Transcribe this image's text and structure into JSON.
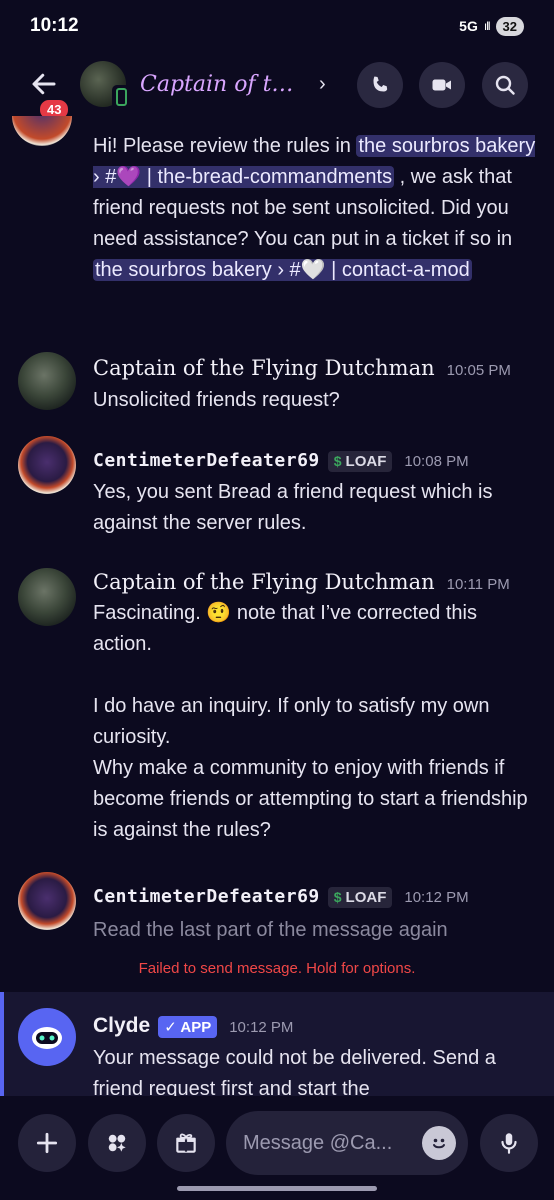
{
  "status_bar": {
    "time": "10:12",
    "network": "5G",
    "signal": "ıll",
    "battery": "32"
  },
  "header": {
    "unread_count": "43",
    "title": "Captain of the Flying Dutchman",
    "chevron": "›",
    "icons": [
      "back-arrow-icon",
      "phone-icon",
      "video-icon",
      "search-icon"
    ]
  },
  "messages": [
    {
      "id": "m0",
      "body_parts": [
        "Hi! Please review the rules in ",
        "the sourbros bakery › #💜 | the-bread-commandments",
        " , we ask that friend requests not be sent unsolicited. Did you need assistance? You can put in a ticket if so in ",
        "the sourbros bakery › #🤍 | contact-a-mod"
      ]
    },
    {
      "id": "m1",
      "author": "Captain of the Flying Dutchman",
      "time": "10:05 PM",
      "body": "Unsolicited friends request?"
    },
    {
      "id": "m2",
      "author": "CentimeterDefeater69",
      "tag_icon": "$",
      "tag": "LOAF",
      "time": "10:08 PM",
      "body": "Yes, you sent Bread a friend request which is against the server rules."
    },
    {
      "id": "m3",
      "author": "Captain of the Flying Dutchman",
      "time": "10:11 PM",
      "body_line1": "Fascinating. 🤨 note that I’ve corrected this action.",
      "body_line2": "I do have an inquiry. If only to satisfy my own curiosity.",
      "body_line3": "Why make a community to enjoy with friends if become friends or attempting to start a friendship is against the rules?"
    },
    {
      "id": "m4",
      "author": "CentimeterDefeater69",
      "tag_icon": "$",
      "tag": "LOAF",
      "time": "10:12 PM",
      "body": "Read the last part of the message again",
      "failed_note": "Failed to send message. Hold for options."
    },
    {
      "id": "m5",
      "author": "Clyde",
      "app_tag": "✓ APP",
      "time": "10:12 PM",
      "body": "Your message could not be delivered. Send a friend request first and start the"
    }
  ],
  "composer": {
    "placeholder": "Message @Ca...",
    "icons": [
      "plus-icon",
      "apps-icon",
      "gift-icon",
      "emoji-icon",
      "microphone-icon"
    ]
  }
}
